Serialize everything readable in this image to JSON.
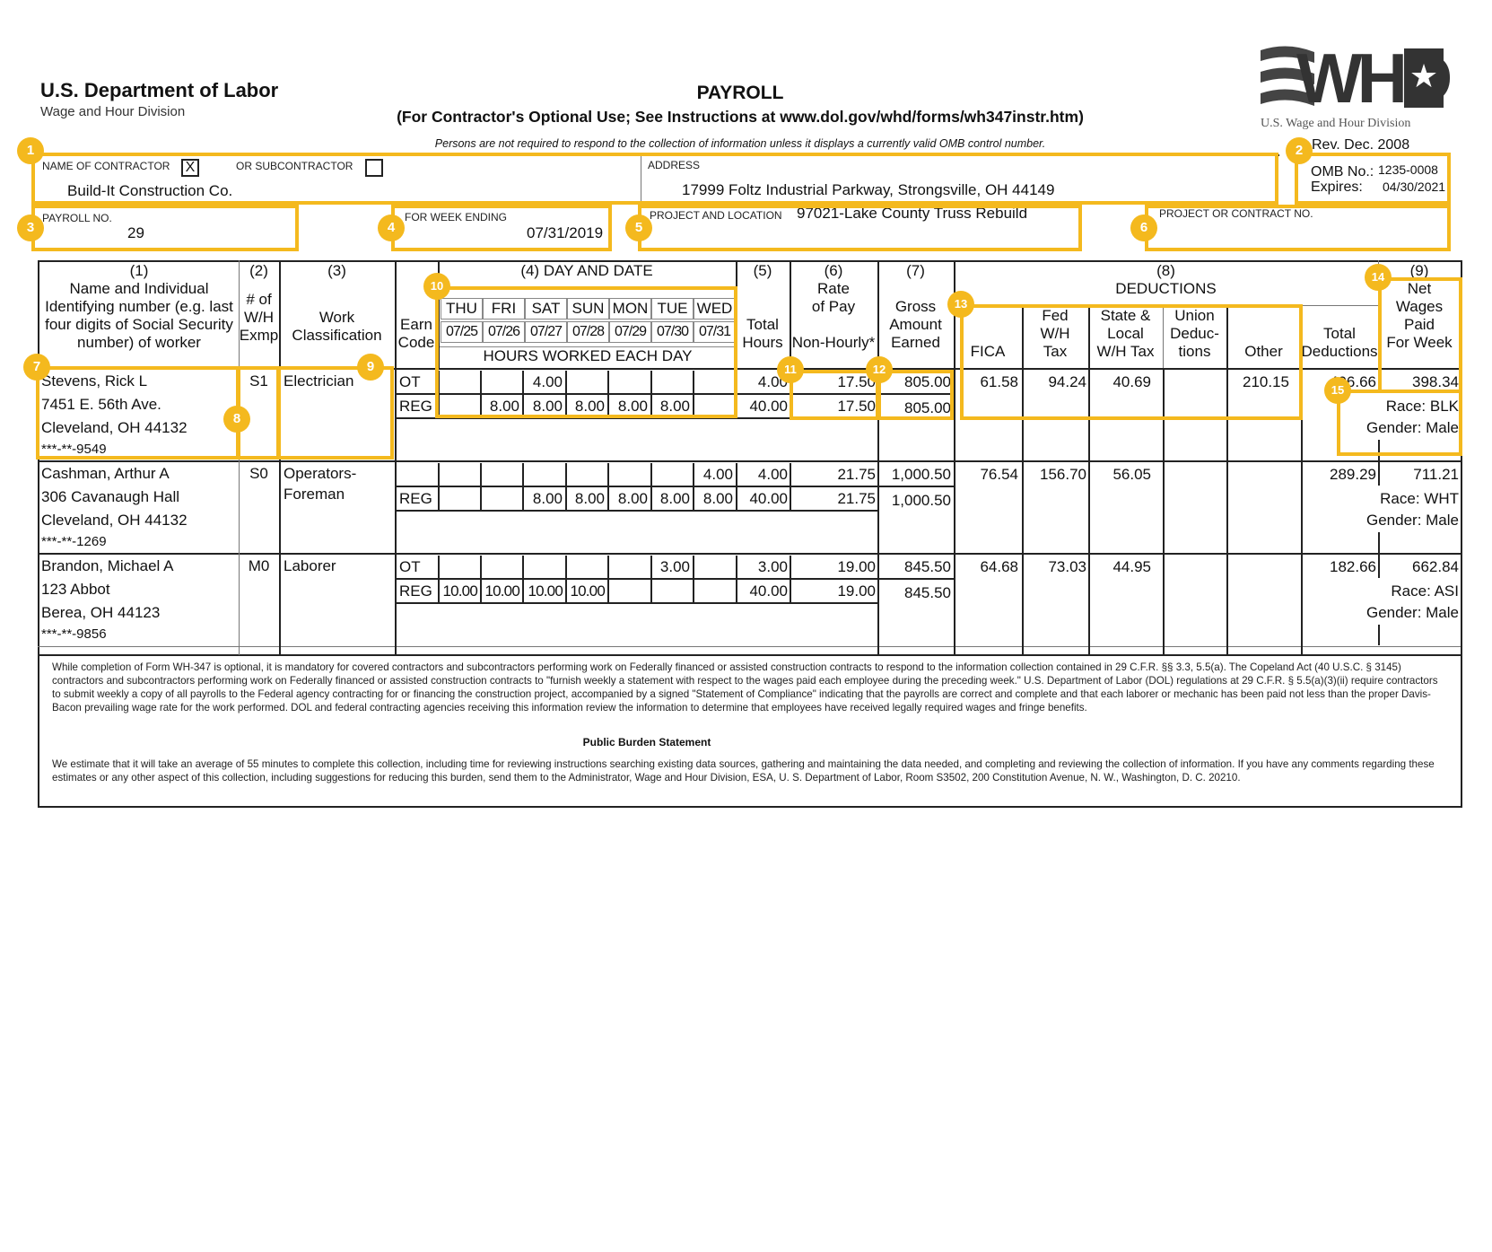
{
  "header": {
    "agency": "U.S. Department of Labor",
    "division": "Wage and Hour Division",
    "title": "PAYROLL",
    "subtitle": "(For Contractor's Optional Use; See Instructions at www.dol.gov/whd/forms/wh347instr.htm)",
    "omb_notice": "Persons are not required to respond to the collection of information unless it displays a currently valid OMB control number.",
    "logo_text": "WHD",
    "logo_caption": "U.S. Wage and Hour Division",
    "rev": "Rev. Dec. 2008",
    "omb_label": "OMB No.:",
    "omb_no": "1235-0008",
    "expires_label": "Expires:",
    "expires": "04/30/2021"
  },
  "form": {
    "contractor_label": "NAME OF CONTRACTOR",
    "contractor_checked": "X",
    "subcontractor_label": "OR SUBCONTRACTOR",
    "subcontractor_checked": "",
    "contractor_name": "Build-It Construction Co.",
    "address_label": "ADDRESS",
    "address": "17999 Foltz Industrial Parkway, Strongsville, OH 44149",
    "payroll_no_label": "PAYROLL NO.",
    "payroll_no": "29",
    "week_ending_label": "FOR WEEK ENDING",
    "week_ending": "07/31/2019",
    "project_location_label": "PROJECT AND LOCATION",
    "project_location": "97021-Lake County Truss Rebuild",
    "project_no_label": "PROJECT OR CONTRACT NO.",
    "project_no": ""
  },
  "columns": {
    "c1_num": "(1)",
    "c1": [
      "Name and Individual",
      "Identifying number (e.g. last",
      "four digits of Social Security",
      "number) of worker"
    ],
    "c2_num": "(2)",
    "c2": [
      "# of",
      "W/H",
      "Exmp"
    ],
    "c3_num": "(3)",
    "c3": [
      "Work",
      "Classification"
    ],
    "earn": [
      "Earn",
      "Code"
    ],
    "c4": "(4) DAY AND DATE",
    "days": [
      "THU",
      "FRI",
      "SAT",
      "SUN",
      "MON",
      "TUE",
      "WED"
    ],
    "dates": [
      "07/25",
      "07/26",
      "07/27",
      "07/28",
      "07/29",
      "07/30",
      "07/31"
    ],
    "hours_each_day": "HOURS WORKED EACH DAY",
    "c5_num": "(5)",
    "c5": [
      "Total",
      "Hours"
    ],
    "c6_num": "(6)",
    "c6": [
      "Rate",
      "of Pay"
    ],
    "c6_sub": "Non-Hourly*",
    "c7_num": "(7)",
    "c7": [
      "Gross",
      "Amount",
      "Earned"
    ],
    "c8_num": "(8)",
    "c8": "DEDUCTIONS",
    "fica": "FICA",
    "fed": [
      "Fed",
      "W/H",
      "Tax"
    ],
    "state": [
      "State &",
      "Local",
      "W/H Tax"
    ],
    "union": [
      "Union",
      "Deduc-",
      "tions"
    ],
    "other": "Other",
    "total_ded": [
      "Total",
      "Deductions"
    ],
    "c9_num": "(9)",
    "c9": [
      "Net",
      "Wages",
      "Paid",
      "For Week"
    ]
  },
  "workers": [
    {
      "name": "Stevens, Rick L",
      "address1": "7451 E. 56th Ave.",
      "address2": "Cleveland, OH 44132",
      "ssn": "***-**-9549",
      "exemptions": "S1",
      "classification": [
        "Electrician",
        ""
      ],
      "ot_code": "OT",
      "reg_code": "REG",
      "ot_hours": [
        "",
        "",
        "4.00",
        "",
        "",
        "",
        ""
      ],
      "reg_hours": [
        "",
        "8.00",
        "8.00",
        "8.00",
        "8.00",
        "8.00",
        ""
      ],
      "ot_total": "4.00",
      "reg_total": "40.00",
      "ot_rate": "17.50",
      "reg_rate": "17.50",
      "ot_gross": "805.00",
      "reg_gross": "805.00",
      "fica": "61.58",
      "fed": "94.24",
      "state": "40.69",
      "union": "",
      "other": "210.15",
      "total_deductions": "406.66",
      "net": "398.34",
      "race": "Race:  BLK",
      "gender": "Gender:  Male"
    },
    {
      "name": "Cashman, Arthur A",
      "address1": "306 Cavanaugh Hall",
      "address2": "Cleveland, OH 44132",
      "ssn": "***-**-1269",
      "exemptions": "S0",
      "classification": [
        "Operators-",
        "Foreman"
      ],
      "ot_code": "",
      "reg_code": "REG",
      "ot_hours": [
        "",
        "",
        "",
        "",
        "",
        "",
        "4.00"
      ],
      "reg_hours": [
        "",
        "",
        "8.00",
        "8.00",
        "8.00",
        "8.00",
        "8.00"
      ],
      "ot_total": "4.00",
      "reg_total": "40.00",
      "ot_rate": "21.75",
      "reg_rate": "21.75",
      "ot_gross": "1,000.50",
      "reg_gross": "1,000.50",
      "fica": "76.54",
      "fed": "156.70",
      "state": "56.05",
      "union": "",
      "other": "",
      "total_deductions": "289.29",
      "net": "711.21",
      "race": "Race: WHT",
      "gender": "Gender:  Male"
    },
    {
      "name": "Brandon, Michael A",
      "address1": "123 Abbot",
      "address2": "Berea, OH 44123",
      "ssn": "***-**-9856",
      "exemptions": "M0",
      "classification": [
        "Laborer",
        ""
      ],
      "ot_code": "OT",
      "reg_code": "REG",
      "ot_hours": [
        "",
        "",
        "",
        "",
        "",
        "3.00",
        ""
      ],
      "reg_hours": [
        "10.00",
        "10.00",
        "10.00",
        "10.00",
        "",
        "",
        ""
      ],
      "ot_total": "3.00",
      "reg_total": "40.00",
      "ot_rate": "19.00",
      "reg_rate": "19.00",
      "ot_gross": "845.50",
      "reg_gross": "845.50",
      "fica": "64.68",
      "fed": "73.03",
      "state": "44.95",
      "union": "",
      "other": "",
      "total_deductions": "182.66",
      "net": "662.84",
      "race": "Race:  ASI",
      "gender": "Gender:  Male"
    }
  ],
  "footer": {
    "notice": "While completion of Form WH-347 is optional, it is mandatory for covered contractors and subcontractors performing work on Federally financed or assisted construction contracts to respond to the information collection contained in 29 C.F.R. §§ 3.3, 5.5(a). The Copeland Act (40 U.S.C. § 3145) contractors and subcontractors performing work on Federally financed or assisted construction contracts to \"furnish weekly a statement with respect to the wages paid each employee during the preceding week.\" U.S. Department of Labor (DOL) regulations at 29 C.F.R. § 5.5(a)(3)(ii) require contractors to submit weekly a copy of all payrolls to the Federal agency contracting for or financing the construction project, accompanied by a signed \"Statement of Compliance\" indicating that the payrolls are correct and complete and that each laborer or mechanic has been paid not less than the proper Davis-Bacon prevailing wage rate for the work performed. DOL and federal contracting agencies receiving this information review the information to determine that employees have received legally required wages and fringe benefits.",
    "burden_title": "Public Burden Statement",
    "burden": "We estimate that it will take an average of 55 minutes to complete this collection, including time for reviewing instructions searching existing data sources, gathering and maintaining the data needed, and completing and reviewing the collection of information.  If you have any comments regarding these estimates or any other aspect of this collection, including suggestions for reducing this burden, send them to the Administrator, Wage and Hour Division, ESA, U. S. Department of Labor, Room S3502, 200 Constitution Avenue, N. W., Washington, D. C. 20210."
  },
  "annotations": {
    "accent_color": "#f4b91e",
    "badges": [
      "1",
      "2",
      "3",
      "4",
      "5",
      "6",
      "7",
      "8",
      "9",
      "10",
      "11",
      "12",
      "13",
      "14",
      "15"
    ]
  }
}
